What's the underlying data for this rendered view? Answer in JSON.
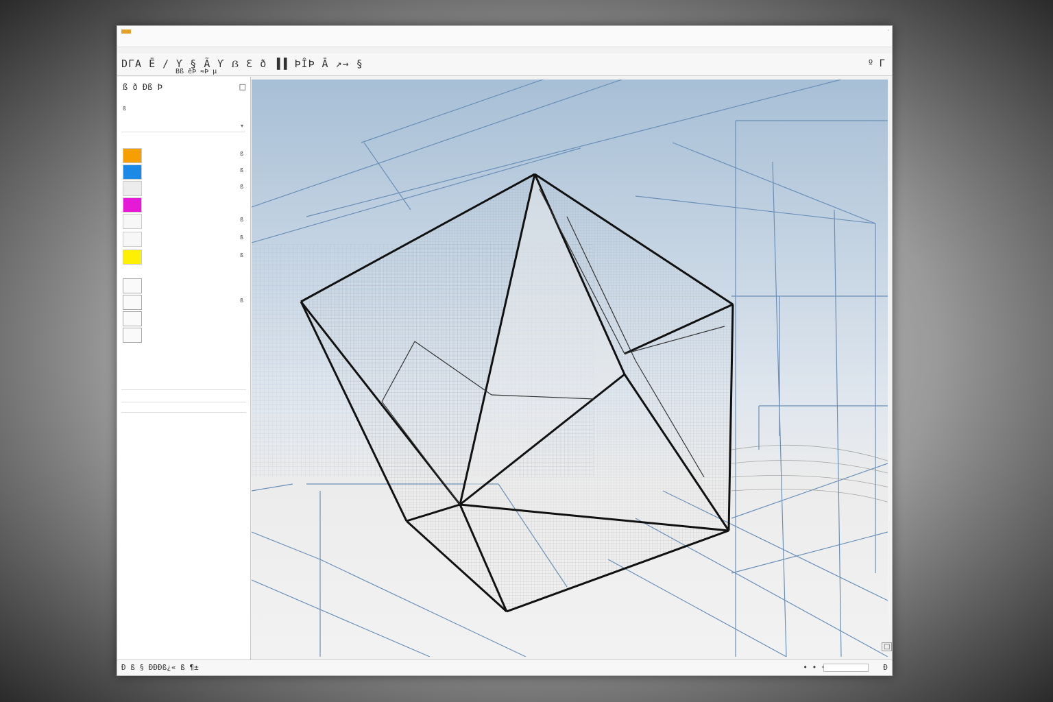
{
  "window": {
    "title": "",
    "corner_glyph": "·",
    "brand_color": "#e5a124"
  },
  "menubar": {
    "items": []
  },
  "toolbar": {
    "row1_glyphs": "DΓA Ē ∕ Ƴ § Ã Ƴ ẞ Ɛ ð ▐▐ ÞÎÞ Ā ↗→ §",
    "row2_glyphs": "Bß êÞ ≈Þ µ",
    "right_glyphs": "º Γ"
  },
  "sidebar": {
    "header_glyphs": "ß  ð  Ðß Þ",
    "layers": [
      {
        "color": "#f59f00"
      },
      {
        "color": "#1a8ae6"
      },
      {
        "color": "#ececec"
      },
      {
        "color": "#e61ad6"
      },
      {
        "color": "#f7f7f7"
      },
      {
        "color": "#f7f7f7"
      },
      {
        "color": "#fef000"
      }
    ]
  },
  "statusbar": {
    "left_glyphs": "Ð ß § ÐÐÐß¿« ß ¶±",
    "right_glyphs": "• • • ß ß",
    "end_glyphs": "Ð"
  },
  "viewport": {
    "background_top": "#a7bfd6",
    "background_bottom": "#efefef",
    "gridline_color": "#6a8fb8",
    "wire_color": "#111111"
  }
}
